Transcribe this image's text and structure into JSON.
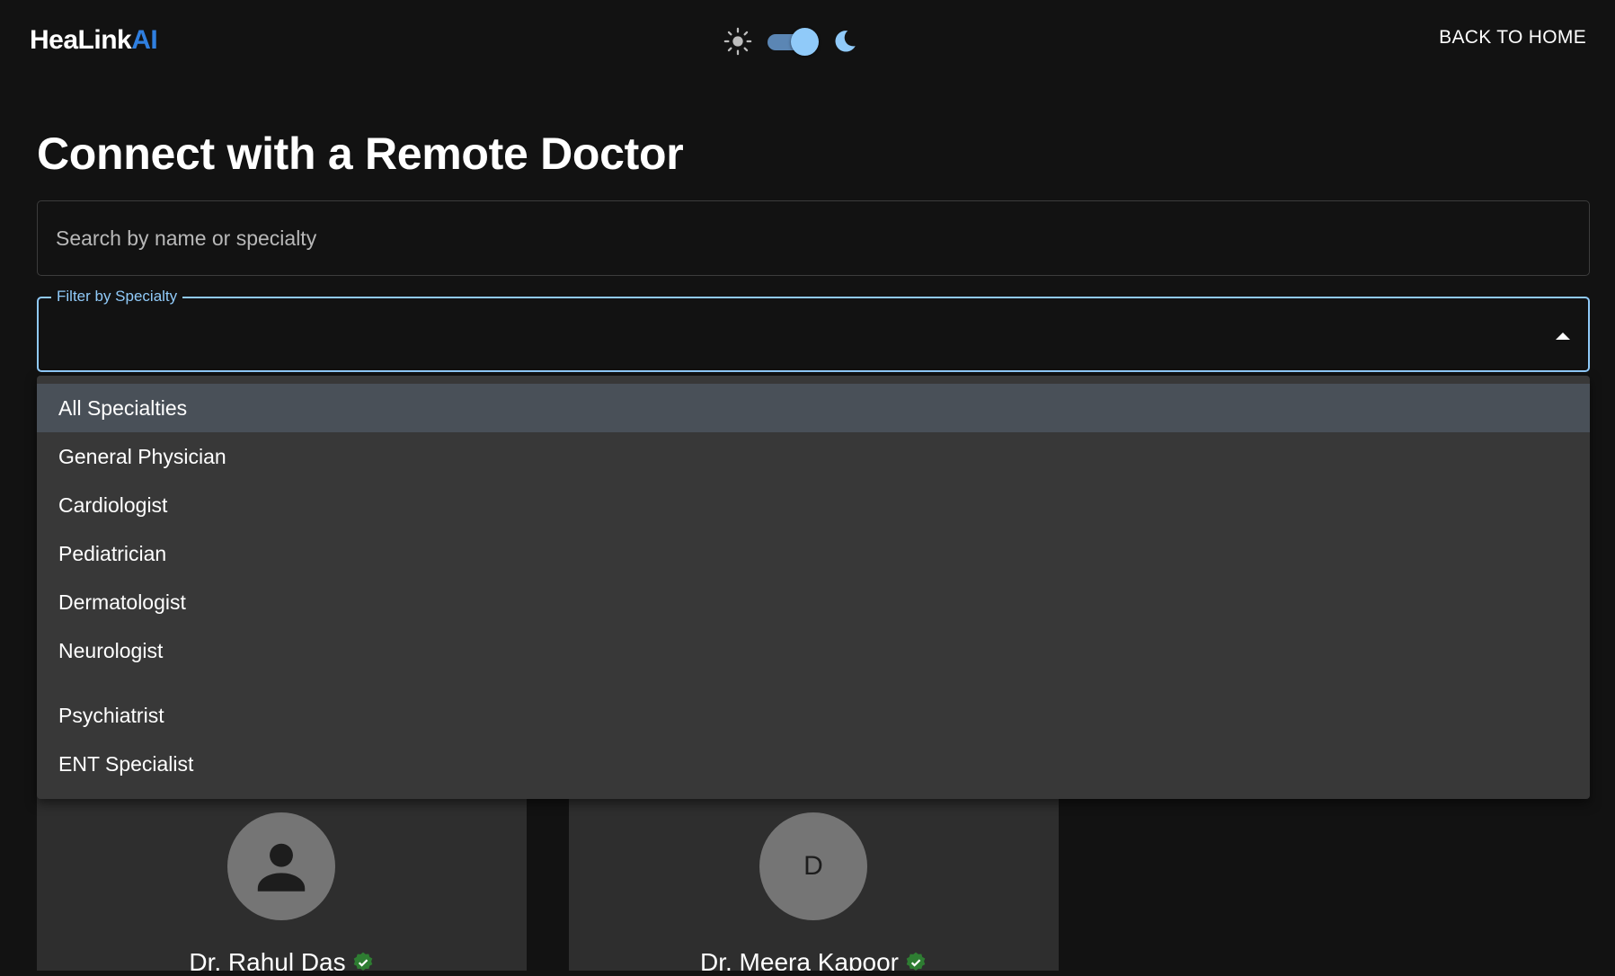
{
  "header": {
    "logo_main": "HeaLink",
    "logo_accent": "AI",
    "back_home": "BACK TO HOME",
    "theme": {
      "mode": "dark",
      "sun_icon": "sun-icon",
      "moon_icon": "moon-icon",
      "toggle_on": true
    }
  },
  "main": {
    "title": "Connect with a Remote Doctor",
    "search": {
      "placeholder": "Search by name or specialty",
      "value": ""
    },
    "filter": {
      "label": "Filter by Specialty",
      "value": "",
      "options": [
        "All Specialties",
        "General Physician",
        "Cardiologist",
        "Pediatrician",
        "Dermatologist",
        "Neurologist",
        "Psychiatrist",
        "ENT Specialist"
      ],
      "highlighted": "All Specialties"
    },
    "doctors": [
      {
        "name": "Dr. Rahul Das",
        "avatar": "person-icon",
        "verified": true
      },
      {
        "name": "Dr. Meera Kapoor",
        "avatar_initial": "D",
        "verified": true
      }
    ]
  },
  "colors": {
    "background": "#121212",
    "accent": "#90caf9",
    "logo_accent": "#2f7fe0",
    "menu_bg": "#383838",
    "menu_selected": "#495058",
    "card_bg": "#2e2e2e",
    "verified": "#2e7d32"
  }
}
